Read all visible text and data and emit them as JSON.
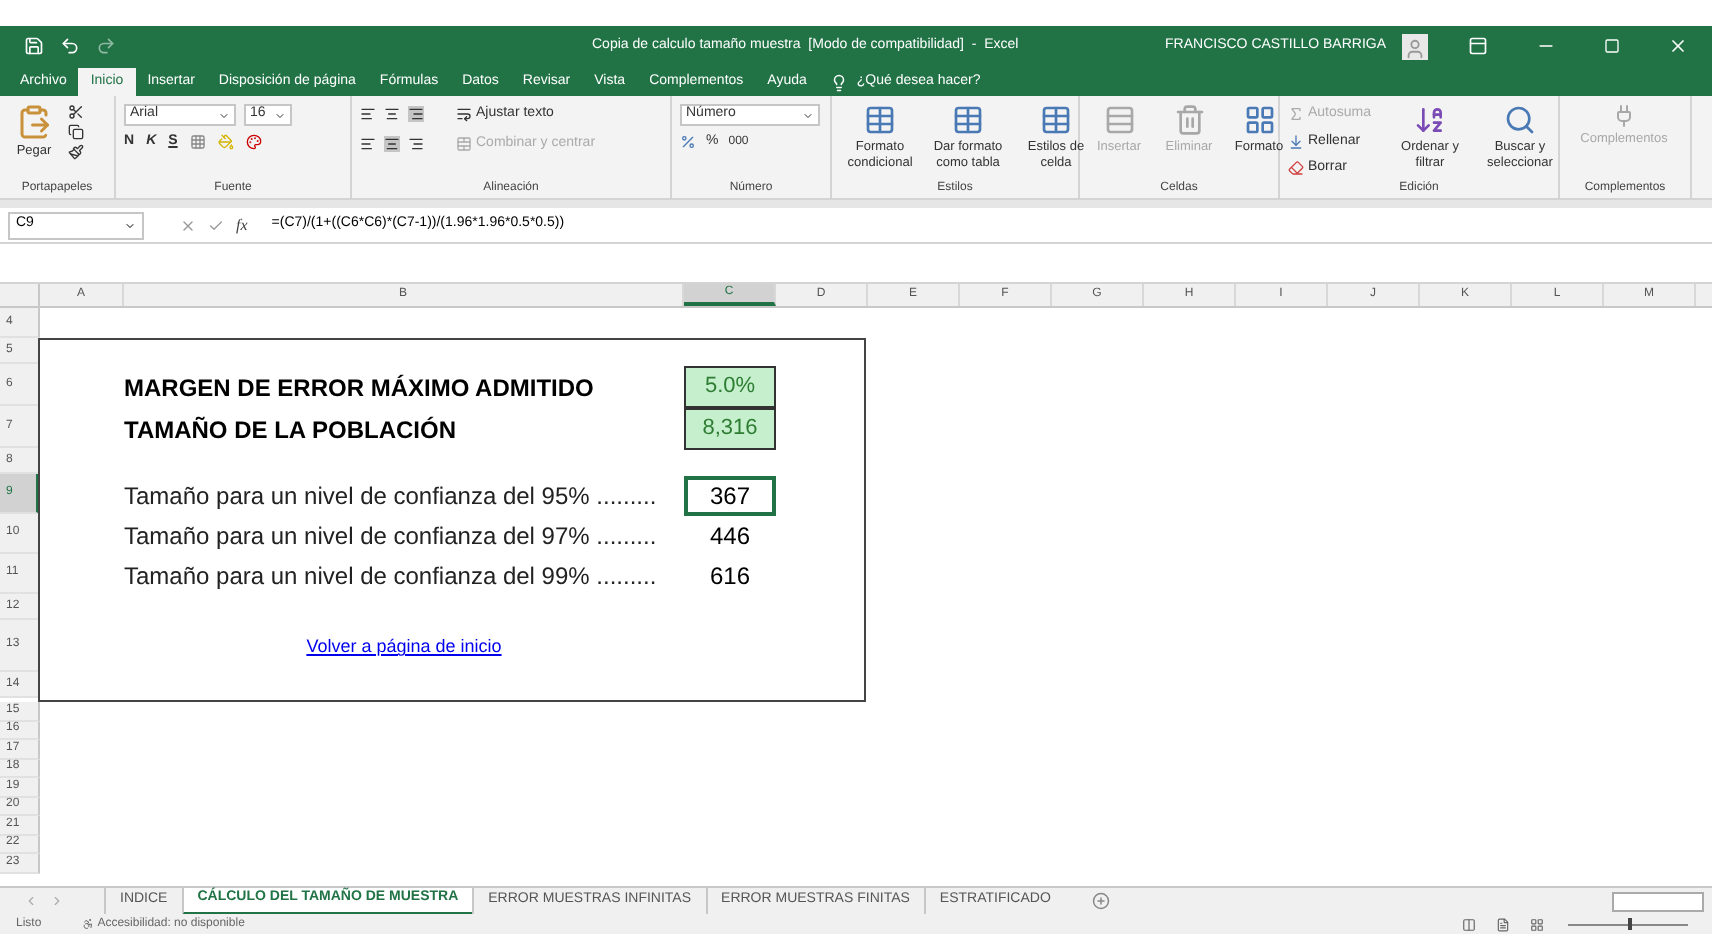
{
  "title_bar": {
    "title": "Copia de calculo tamaño muestra  [Modo de compatibilidad]  -  Excel",
    "user": "FRANCISCO CASTILLO BARRIGA"
  },
  "menu_tabs": [
    {
      "label": "Archivo",
      "selected": false
    },
    {
      "label": "Inicio",
      "selected": true
    },
    {
      "label": "Insertar",
      "selected": false
    },
    {
      "label": "Disposición de página",
      "selected": false
    },
    {
      "label": "Fórmulas",
      "selected": false
    },
    {
      "label": "Datos",
      "selected": false
    },
    {
      "label": "Revisar",
      "selected": false
    },
    {
      "label": "Vista",
      "selected": false
    },
    {
      "label": "Complementos",
      "selected": false
    },
    {
      "label": "Ayuda",
      "selected": false
    }
  ],
  "tell_me": {
    "placeholder": "¿Qué desea hacer?"
  },
  "ribbon": {
    "clipboard": {
      "paste": "Pegar",
      "label": "Portapapeles"
    },
    "font": {
      "name": "Arial",
      "size": "16",
      "bold": "N",
      "italic": "K",
      "underline": "S",
      "label": "Fuente"
    },
    "alignment": {
      "wrap": "Ajustar texto",
      "merge": {
        "label": "Combinar y centrar",
        "disabled": true
      },
      "label": "Alineación"
    },
    "number": {
      "format": "Número",
      "percent": "%",
      "thousands": "000",
      "label": "Número"
    },
    "styles": {
      "buttons": [
        "Formato condicional",
        "Dar formato como tabla",
        "Estilos de celda"
      ],
      "label": "Estilos"
    },
    "cells": {
      "buttons": [
        {
          "label": "Insertar",
          "disabled": true
        },
        {
          "label": "Eliminar",
          "disabled": true
        },
        {
          "label": "Formato",
          "disabled": false
        }
      ],
      "label": "Celdas"
    },
    "editing": {
      "autosum": {
        "label": "Autosuma",
        "disabled": true
      },
      "fill": "Rellenar",
      "clear": "Borrar",
      "sort": "Ordenar y filtrar",
      "find": "Buscar y seleccionar",
      "label": "Edición"
    },
    "addins": {
      "button": {
        "label": "Complementos",
        "disabled": true
      },
      "label": "Complementos"
    }
  },
  "formula_bar": {
    "name_box": "C9",
    "fx": "fx",
    "formula": "=(C7)/(1+((C6*C6)*(C7-1))/(1.96*1.96*0.5*0.5))"
  },
  "sheet": {
    "columns": [
      {
        "label": "A",
        "selected": false
      },
      {
        "label": "B",
        "selected": false
      },
      {
        "label": "C",
        "selected": true
      },
      {
        "label": "D",
        "selected": false
      },
      {
        "label": "E",
        "selected": false
      },
      {
        "label": "F",
        "selected": false
      },
      {
        "label": "G",
        "selected": false
      },
      {
        "label": "H",
        "selected": false
      },
      {
        "label": "I",
        "selected": false
      },
      {
        "label": "J",
        "selected": false
      },
      {
        "label": "K",
        "selected": false
      },
      {
        "label": "L",
        "selected": false
      },
      {
        "label": "M",
        "selected": false
      }
    ],
    "rows_above": [
      {
        "number": "4",
        "selected": false
      }
    ],
    "box_rows": [
      {
        "number": "5",
        "selected": false,
        "kind": "spacer"
      },
      {
        "number": "6",
        "selected": false,
        "kind": "input",
        "label": "MARGEN DE ERROR MÁXIMO ADMITIDO",
        "value": "5.0%"
      },
      {
        "number": "7",
        "selected": false,
        "kind": "input",
        "label": "TAMAÑO DE LA POBLACIÓN",
        "value": "8,316"
      },
      {
        "number": "8",
        "selected": false,
        "kind": "spacer"
      },
      {
        "number": "9",
        "selected": true,
        "kind": "result",
        "label": "Tamaño para un nivel de confianza del 95% .........",
        "value": "367",
        "active": true
      },
      {
        "number": "10",
        "selected": false,
        "kind": "result",
        "label": "Tamaño para un nivel de confianza del 97% .........",
        "value": "446",
        "active": false
      },
      {
        "number": "11",
        "selected": false,
        "kind": "result",
        "label": "Tamaño para un nivel de confianza del 99% .........",
        "value": "616",
        "active": false
      },
      {
        "number": "12",
        "selected": false,
        "kind": "spacer"
      },
      {
        "number": "13",
        "selected": false,
        "kind": "link",
        "label": "Volver a página de inicio"
      },
      {
        "number": "14",
        "selected": false,
        "kind": "spacer"
      }
    ],
    "rows_below": [
      {
        "number": "15",
        "selected": false
      },
      {
        "number": "16",
        "selected": false
      },
      {
        "number": "17",
        "selected": false
      },
      {
        "number": "18",
        "selected": false
      },
      {
        "number": "19",
        "selected": false
      },
      {
        "number": "20",
        "selected": false
      },
      {
        "number": "21",
        "selected": false
      },
      {
        "number": "22",
        "selected": false
      },
      {
        "number": "23",
        "selected": false
      }
    ]
  },
  "sheet_tabs": [
    {
      "label": "INDICE",
      "selected": false
    },
    {
      "label": "CÁLCULO DEL TAMAÑO DE MUESTRA",
      "selected": true
    },
    {
      "label": "ERROR MUESTRAS INFINITAS",
      "selected": false
    },
    {
      "label": "ERROR MUESTRAS FINITAS",
      "selected": false
    },
    {
      "label": "ESTRATIFICADO",
      "selected": false
    }
  ],
  "status_bar": {
    "state": "Listo",
    "accessibility": "Accesibilidad: no disponible",
    "zoom": {
      "level": 0.5
    }
  }
}
